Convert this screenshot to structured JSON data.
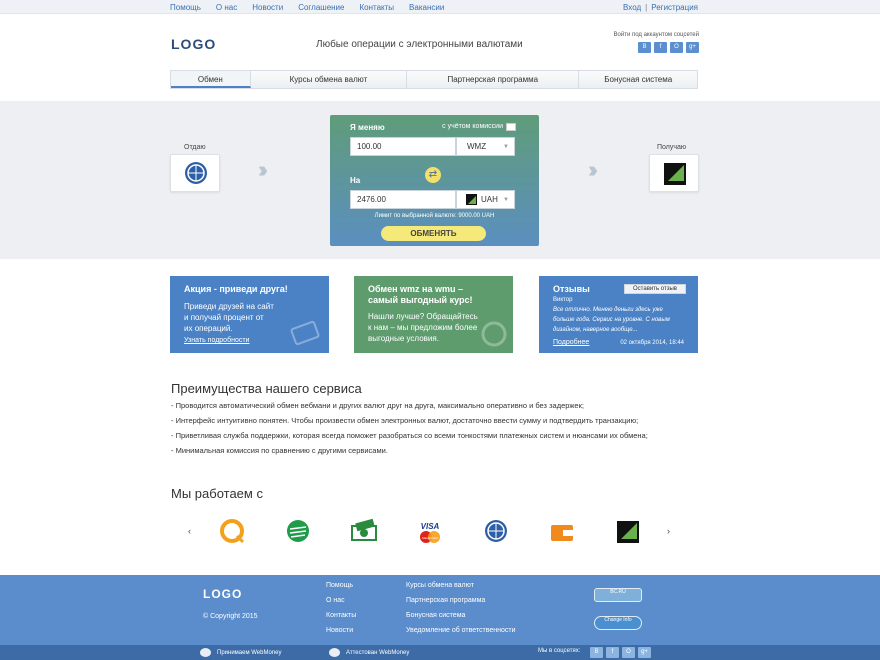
{
  "topnav": {
    "items": [
      "Помощь",
      "О нас",
      "Новости",
      "Соглашение",
      "Контакты",
      "Вакансии"
    ],
    "login": "Вход",
    "separator": "|",
    "register": "Регистрация"
  },
  "header": {
    "logo": "LOGO",
    "tagline": "Любые операции с электронными валютами",
    "social_label": "Войти под аккаунтом соцсетей",
    "social": [
      "В",
      "f",
      "О",
      "g+"
    ]
  },
  "tabs": [
    "Обмен",
    "Курсы обмена валют",
    "Партнерская программа",
    "Бонусная система"
  ],
  "exchange": {
    "give_side_label": "Отдаю",
    "receive_side_label": "Получаю",
    "give_title": "Я меняю",
    "commission_label": "с учётом комиссии",
    "give_amount": "100.00",
    "give_currency": "WMZ",
    "to_label": "На",
    "receive_amount": "2476.00",
    "receive_currency": "UAH",
    "limit_text": "Лимит по выбранной валюте:  9000.00 UAH",
    "submit": "ОБМЕНЯТЬ"
  },
  "cards": {
    "promo": {
      "title": "Акция - приведи друга!",
      "text": [
        "Приведи друзей на сайт",
        "и получай процент от",
        "их операций."
      ],
      "link": "Узнать подробности"
    },
    "exchange_offer": {
      "title": [
        "Обмен wmz на wmu –",
        "самый выгодный курс!"
      ],
      "text": [
        "Нашли лучше? Обращайтесь",
        "к нам – мы предложим более",
        "выгодные условия."
      ]
    },
    "reviews": {
      "title": "Отзывы",
      "leave_button": "Оставить отзыв",
      "author": "Виктор",
      "text": "Все отлично. Менею деньги здесь уже больше года. Сервис на уровне. С новым дизайном, наверное вообще...",
      "more": "Подробнее",
      "date": "02 октября 2014, 18:44"
    }
  },
  "advantages": {
    "heading": "Преимущества нашего сервиса",
    "items": [
      "- Проводится автоматический обмен вебмани и других валют друг на друга, максимально оперативно и без задержек;",
      "- Интерфейс интуитивно понятен. Чтобы произвести обмен электронных валют, достаточно ввести сумму и подтвердить транзакцию;",
      "- Приветливая служба поддержки, которая всегда поможет разобраться со всеми тонкостями платежных систем и нюансами их обмена;",
      "- Минимальная комиссия по сравнению с другими сервисами."
    ]
  },
  "partners": {
    "heading": "Мы работаем с",
    "prev": "‹",
    "next": "›",
    "logos": [
      "qiwi-icon",
      "sberbank-icon",
      "cash-icon",
      "visa-mastercard-icon",
      "webmoney-icon",
      "wallet-icon",
      "privatbank-icon"
    ],
    "visa_text": "VISA",
    "mc_text": "MasterCard"
  },
  "footer": {
    "logo": "LOGO",
    "copyright": "© Copyright 2015",
    "col1": [
      "Помощь",
      "О нас",
      "Контакты",
      "Новости"
    ],
    "col2": [
      "Курсы обмена валют",
      "Партнерская программа",
      "Бонусная система",
      "Уведомление об ответственности"
    ],
    "badge1": "BC.RU",
    "badge2": "Change Info",
    "accept_wm": "Принимаем WebMoney",
    "attested_wm": "Аттестован WebMoney",
    "social_label": "Мы в соцсетях:",
    "social": [
      "В",
      "f",
      "О",
      "g+"
    ]
  },
  "colors": {
    "accent_blue": "#4a82c5",
    "accent_green": "#5e9c6e",
    "button_yellow": "#f5e97a",
    "footer_blue": "#5b8ccb"
  }
}
